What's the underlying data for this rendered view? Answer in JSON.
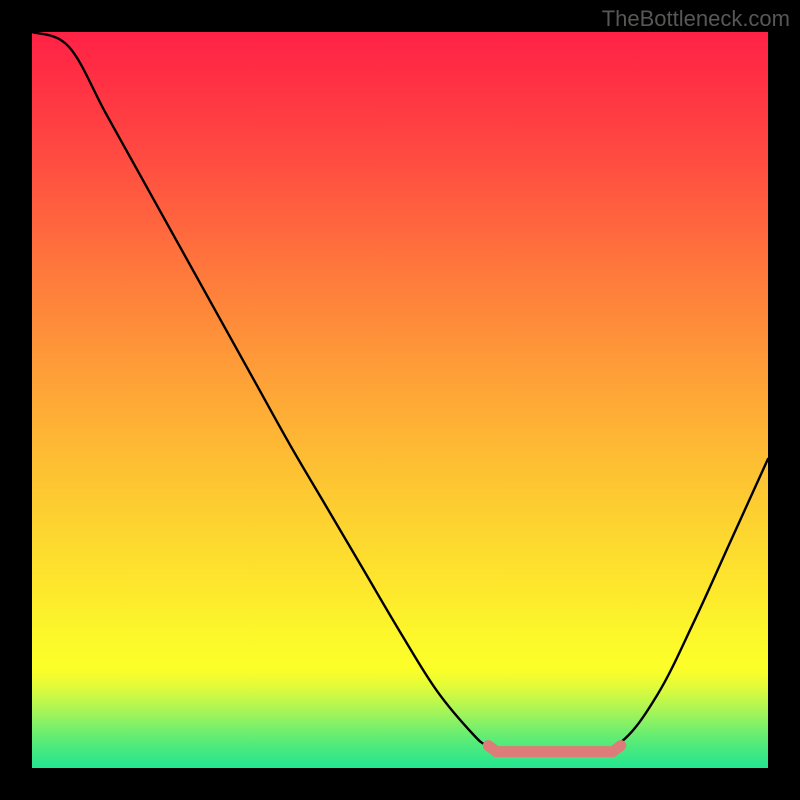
{
  "watermark": "TheBottleneck.com",
  "colors": {
    "flat_highlight": "#dd7c78",
    "curve": "#000000"
  },
  "gradient_stops": [
    {
      "offset": 0.0,
      "color": "#ff2246"
    },
    {
      "offset": 0.06,
      "color": "#ff2f44"
    },
    {
      "offset": 0.12,
      "color": "#ff3e42"
    },
    {
      "offset": 0.18,
      "color": "#ff4e41"
    },
    {
      "offset": 0.24,
      "color": "#ff5f3f"
    },
    {
      "offset": 0.3,
      "color": "#ff713d"
    },
    {
      "offset": 0.36,
      "color": "#fe823b"
    },
    {
      "offset": 0.42,
      "color": "#fe9339"
    },
    {
      "offset": 0.48,
      "color": "#fea337"
    },
    {
      "offset": 0.54,
      "color": "#feb335"
    },
    {
      "offset": 0.6,
      "color": "#fdc232"
    },
    {
      "offset": 0.66,
      "color": "#fdd130"
    },
    {
      "offset": 0.72,
      "color": "#fddf2e"
    },
    {
      "offset": 0.77,
      "color": "#fdeb2c"
    },
    {
      "offset": 0.8,
      "color": "#fcf32b"
    },
    {
      "offset": 0.83,
      "color": "#fcf92a"
    },
    {
      "offset": 0.855,
      "color": "#fcfd29"
    },
    {
      "offset": 0.865,
      "color": "#fbfe29"
    },
    {
      "offset": 0.875,
      "color": "#f3fd2e"
    },
    {
      "offset": 0.89,
      "color": "#e0fb3a"
    },
    {
      "offset": 0.905,
      "color": "#c7f847"
    },
    {
      "offset": 0.92,
      "color": "#abf555"
    },
    {
      "offset": 0.935,
      "color": "#8ef262"
    },
    {
      "offset": 0.95,
      "color": "#71ee6e"
    },
    {
      "offset": 0.965,
      "color": "#56eb79"
    },
    {
      "offset": 0.98,
      "color": "#3ee983"
    },
    {
      "offset": 0.992,
      "color": "#2de78b"
    },
    {
      "offset": 1.0,
      "color": "#25e68e"
    }
  ],
  "chart_data": {
    "type": "line",
    "title": "",
    "xlabel": "",
    "ylabel": "",
    "xlim": [
      0,
      100
    ],
    "ylim": [
      0,
      100
    ],
    "x": [
      0,
      5,
      10,
      15,
      20,
      25,
      30,
      35,
      40,
      45,
      50,
      55,
      60,
      62,
      65,
      68,
      70,
      75,
      80,
      85,
      90,
      95,
      100
    ],
    "values": [
      100,
      98,
      89,
      80,
      71,
      62,
      53,
      44,
      35.5,
      27,
      18.5,
      10.5,
      4.5,
      3,
      2,
      2,
      2,
      2,
      3.5,
      10,
      20,
      31,
      42
    ],
    "flat_region": {
      "x_start": 62,
      "x_end": 80,
      "y": 2.5
    },
    "note": "Bottleneck-style curve: steep descent from top-left, flat valley highlighted in salmon, then rises toward the right."
  }
}
